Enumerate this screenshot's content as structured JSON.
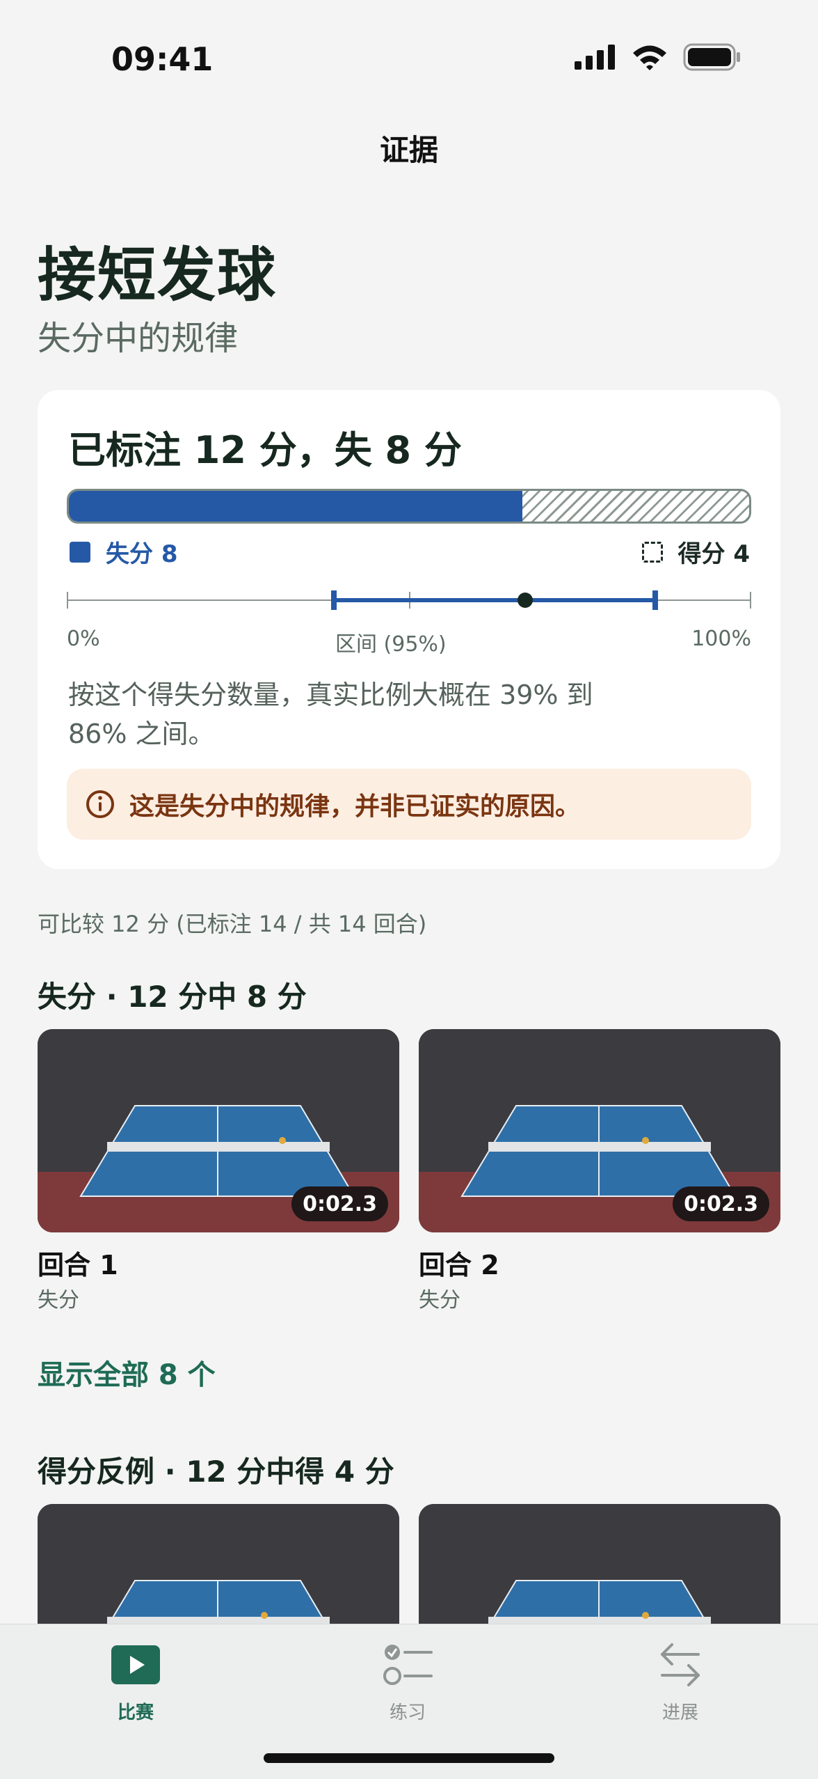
{
  "status_bar": {
    "time": "09:41"
  },
  "nav": {
    "title": "证据"
  },
  "header": {
    "title": "接短发球",
    "subtitle": "失分中的规律"
  },
  "summary": {
    "headline": "已标注 12 分，失 8 分",
    "lost_count": 8,
    "won_count": 4,
    "total": 12,
    "lost_fraction": 0.667,
    "legend_lost": "失分 8",
    "legend_won": "得分 4",
    "ci": {
      "low_pct": 39,
      "high_pct": 86,
      "point_pct": 67,
      "label_min": "0%",
      "label_mid": "区间 (95%)",
      "label_max": "100%"
    },
    "explanation": "按这个得失分数量，真实比例大概在 39% 到 86% 之间。",
    "note": "这是失分中的规律，并非已证实的原因。"
  },
  "comparable": "可比较 12 分 (已标注 14 / 共 14 回合)",
  "lost_section": {
    "title": "失分 · 12 分中 8 分",
    "clips": [
      {
        "title": "回合 1",
        "subtitle": "失分",
        "duration": "0:02.3"
      },
      {
        "title": "回合 2",
        "subtitle": "失分",
        "duration": "0:02.3"
      }
    ],
    "show_all": "显示全部 8 个"
  },
  "won_section": {
    "title": "得分反例 · 12 分中得 4 分"
  },
  "tabs": [
    {
      "label": "比赛",
      "icon": "play-icon",
      "active": true
    },
    {
      "label": "练习",
      "icon": "checklist-icon",
      "active": false
    },
    {
      "label": "进展",
      "icon": "arrows-icon",
      "active": false
    }
  ],
  "colors": {
    "accent": "#2559a6",
    "brand": "#1f6b55",
    "note_bg": "#fdeee2",
    "note_text": "#7a3511"
  }
}
